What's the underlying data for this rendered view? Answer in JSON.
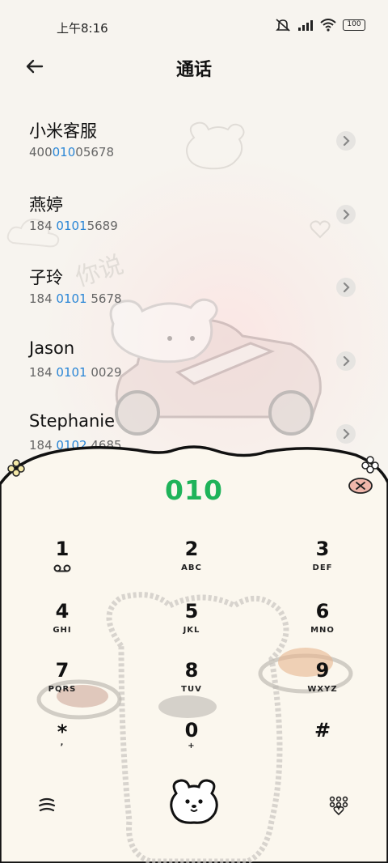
{
  "status_bar": {
    "time": "上午8:16",
    "battery": "100"
  },
  "header": {
    "title": "通话"
  },
  "contacts": [
    {
      "name": "小米客服",
      "number_pre": "400",
      "number_hl": "010",
      "number_post": "05678"
    },
    {
      "name": "燕婷",
      "number_pre": "184 ",
      "number_hl": "0101",
      "number_post": "5689"
    },
    {
      "name": "子玲",
      "number_pre": "184 ",
      "number_hl": "0101",
      "number_post": " 5678"
    },
    {
      "name": "Jason",
      "number_pre": "184 ",
      "number_hl": "0101",
      "number_post": " 0029"
    },
    {
      "name": "Stephanie",
      "number_pre": "184 ",
      "number_hl": "0102",
      "number_post": " 4685"
    }
  ],
  "watermark": "你说",
  "dialer": {
    "typed": "010",
    "keys": [
      {
        "digit": "1",
        "letters": ""
      },
      {
        "digit": "2",
        "letters": "ABC"
      },
      {
        "digit": "3",
        "letters": "DEF"
      },
      {
        "digit": "4",
        "letters": "GHI"
      },
      {
        "digit": "5",
        "letters": "JKL"
      },
      {
        "digit": "6",
        "letters": "MNO"
      },
      {
        "digit": "7",
        "letters": "PQRS"
      },
      {
        "digit": "8",
        "letters": "TUV"
      },
      {
        "digit": "9",
        "letters": "WXYZ"
      },
      {
        "digit": "*",
        "letters": ","
      },
      {
        "digit": "0",
        "letters": "+"
      },
      {
        "digit": "#",
        "letters": ""
      }
    ]
  },
  "colors": {
    "accent_green": "#1fb35a",
    "highlight_blue": "#2a86d6",
    "panel_bg": "#fbf7ee"
  }
}
